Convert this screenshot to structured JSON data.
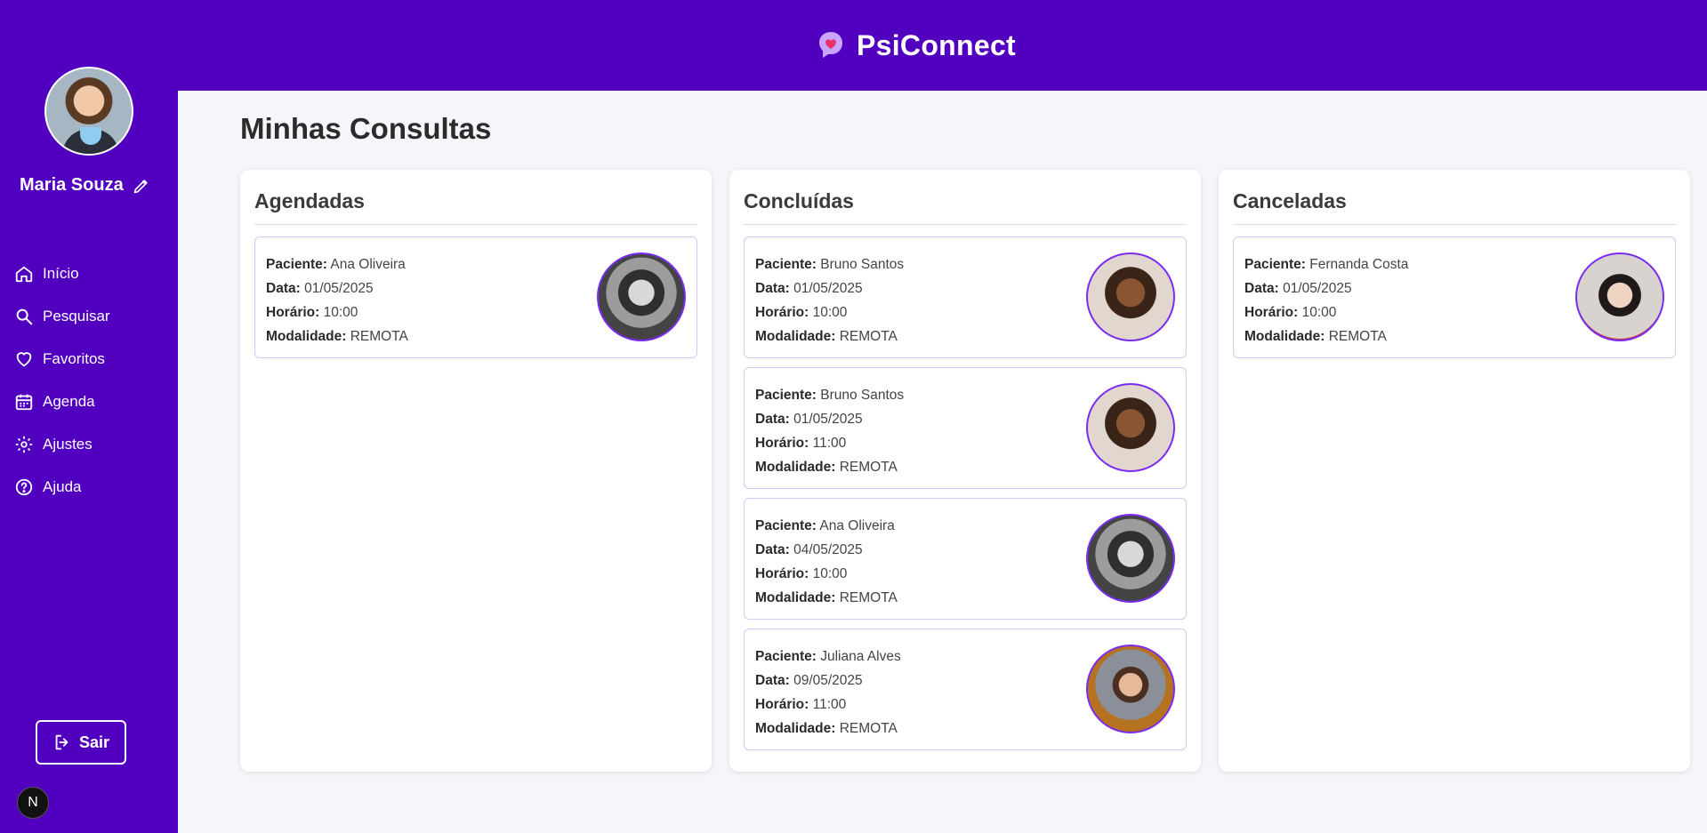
{
  "app": {
    "brand": "PsiConnect"
  },
  "user": {
    "name": "Maria Souza"
  },
  "sidebar": {
    "items": [
      {
        "label": "Início",
        "icon": "home-icon"
      },
      {
        "label": "Pesquisar",
        "icon": "search-icon"
      },
      {
        "label": "Favoritos",
        "icon": "heart-icon"
      },
      {
        "label": "Agenda",
        "icon": "calendar-icon"
      },
      {
        "label": "Ajustes",
        "icon": "gear-icon"
      },
      {
        "label": "Ajuda",
        "icon": "help-icon"
      }
    ],
    "logout_label": "Sair",
    "badge_letter": "N"
  },
  "page": {
    "title": "Minhas Consultas"
  },
  "labels": {
    "patient": "Paciente:",
    "date": "Data:",
    "time": "Horário:",
    "mode": "Modalidade:"
  },
  "columns": [
    {
      "title": "Agendadas",
      "cards": [
        {
          "patient": "Ana Oliveira",
          "date": "01/05/2025",
          "time": "10:00",
          "mode": "REMOTA"
        }
      ]
    },
    {
      "title": "Concluídas",
      "cards": [
        {
          "patient": "Bruno Santos",
          "date": "01/05/2025",
          "time": "10:00",
          "mode": "REMOTA"
        },
        {
          "patient": "Bruno Santos",
          "date": "01/05/2025",
          "time": "11:00",
          "mode": "REMOTA"
        },
        {
          "patient": "Ana Oliveira",
          "date": "04/05/2025",
          "time": "10:00",
          "mode": "REMOTA"
        },
        {
          "patient": "Juliana Alves",
          "date": "09/05/2025",
          "time": "11:00",
          "mode": "REMOTA"
        }
      ]
    },
    {
      "title": "Canceladas",
      "cards": [
        {
          "patient": "Fernanda Costa",
          "date": "01/05/2025",
          "time": "10:00",
          "mode": "REMOTA"
        }
      ]
    }
  ],
  "colors": {
    "brand_purple": "#5200c0",
    "accent_border": "#7a2cf0"
  }
}
